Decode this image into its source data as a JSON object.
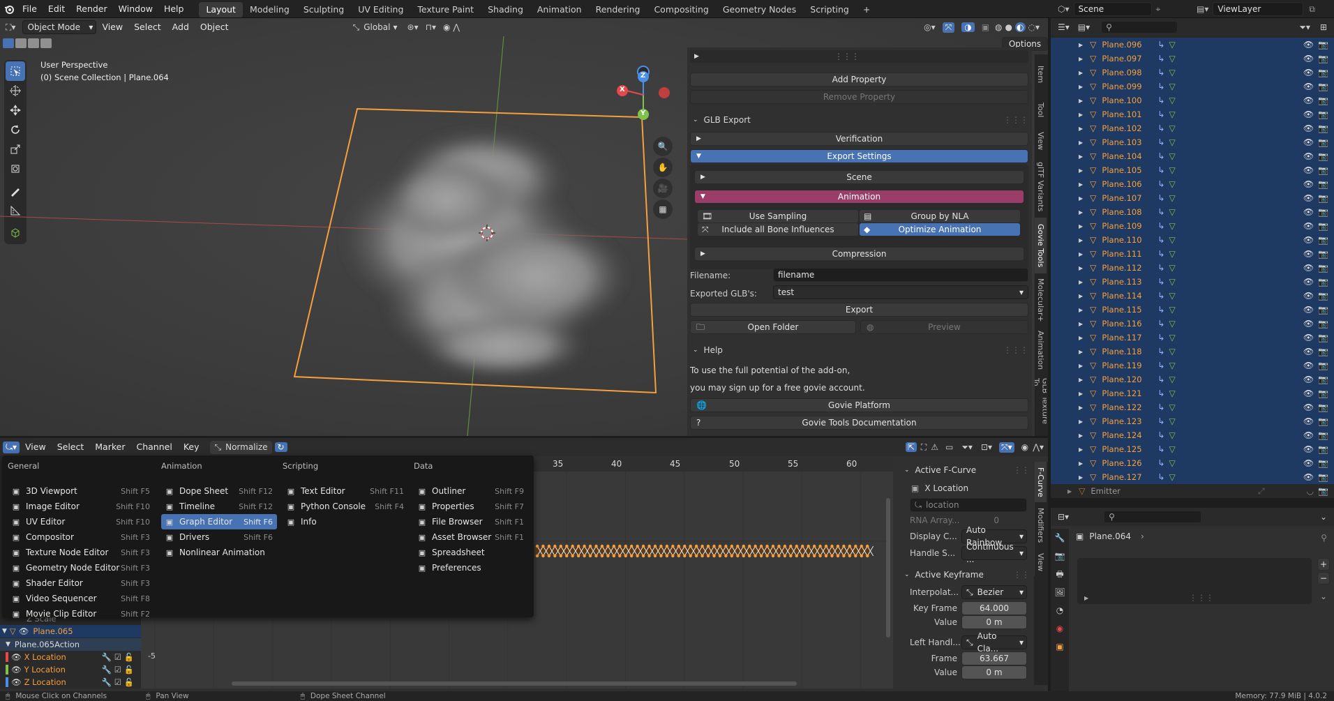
{
  "topbar": {
    "menus": [
      "File",
      "Edit",
      "Render",
      "Window",
      "Help"
    ],
    "workspaces": [
      "Layout",
      "Modeling",
      "Sculpting",
      "UV Editing",
      "Texture Paint",
      "Shading",
      "Animation",
      "Rendering",
      "Compositing",
      "Geometry Nodes",
      "Scripting"
    ],
    "active_workspace": "Layout",
    "add_tab": "+",
    "scene": "Scene",
    "view_layer": "ViewLayer"
  },
  "viewport": {
    "mode": "Object Mode",
    "menus": [
      "View",
      "Select",
      "Add",
      "Object"
    ],
    "transform": "Global",
    "options": "Options",
    "overlay_line1": "User Perspective",
    "overlay_line2": "(0) Scene Collection | Plane.064",
    "gizmo": {
      "z": "Z",
      "y": "Y",
      "x": "X"
    }
  },
  "npanel": {
    "tabs": [
      "Item",
      "Tool",
      "View",
      "glTF Variants",
      "Govie Tools",
      "Molecular+",
      "Animation",
      "GLB Texture To"
    ],
    "add_property": "Add Property",
    "remove_property": "Remove Property",
    "glb_export": "GLB Export",
    "verification": "Verification",
    "export_settings": "Export Settings",
    "scene": "Scene",
    "animation": "Animation",
    "use_sampling": "Use Sampling",
    "group_by_nla": "Group by NLA",
    "include_bone": "Include all Bone Influences",
    "optimize": "Optimize Animation",
    "compression": "Compression",
    "filename_label": "Filename:",
    "filename_value": "filename",
    "exported_label": "Exported GLB's:",
    "exported_value": "test",
    "export": "Export",
    "open_folder": "Open Folder",
    "preview": "Preview",
    "help": "Help",
    "help_line1": "To use the full potential of the add-on,",
    "help_line2": "you may sign up for a free govie account.",
    "govie_platform": "Govie Platform",
    "govie_docs": "Govie Tools Documentation"
  },
  "outliner": {
    "items": [
      "Plane.096",
      "Plane.097",
      "Plane.098",
      "Plane.099",
      "Plane.100",
      "Plane.101",
      "Plane.102",
      "Plane.103",
      "Plane.104",
      "Plane.105",
      "Plane.106",
      "Plane.107",
      "Plane.108",
      "Plane.109",
      "Plane.110",
      "Plane.111",
      "Plane.112",
      "Plane.113",
      "Plane.114",
      "Plane.115",
      "Plane.116",
      "Plane.117",
      "Plane.118",
      "Plane.119",
      "Plane.120",
      "Plane.121",
      "Plane.122",
      "Plane.123",
      "Plane.124",
      "Plane.125",
      "Plane.126",
      "Plane.127"
    ],
    "emitter": "Emitter"
  },
  "properties": {
    "object": "Plane.064"
  },
  "graph": {
    "menus": [
      "View",
      "Select",
      "Marker",
      "Channel",
      "Key"
    ],
    "normalize": "Normalize",
    "ticks": [
      "35",
      "40",
      "45",
      "50",
      "55",
      "60"
    ],
    "y_tick": "-5",
    "channels": {
      "scale": "Z Scale",
      "object": "Plane.065",
      "action": "Plane.065Action",
      "x": "X Location",
      "y": "Y Location",
      "z": "Z Location"
    },
    "side_tabs": [
      "F-Curve",
      "Modifiers",
      "View"
    ],
    "active_fcurve": "Active F-Curve",
    "fcurve_name": "X Location",
    "data_path": "location",
    "rna_label": "RNA Array...",
    "rna_value": "0",
    "display_color_label": "Display C...",
    "display_color": "Auto Rainbow",
    "handle_smoothing_label": "Handle S...",
    "handle_smoothing": "Continuous ...",
    "active_keyframe": "Active Keyframe",
    "interp_label": "Interpolat...",
    "interp": "Bezier",
    "keyframe_label": "Key Frame",
    "keyframe": "64.000",
    "value_label": "Value",
    "value": "0 m",
    "left_handle_label": "Left Handl...",
    "left_handle": "Auto Cla...",
    "frame_label": "Frame",
    "frame": "63.667",
    "value2_label": "Value",
    "value2": "0 m"
  },
  "editor_menu": {
    "columns": [
      {
        "title": "General",
        "items": [
          {
            "label": "3D Viewport",
            "key": "Shift F5",
            "icon": "viewport-icon"
          },
          {
            "label": "Image Editor",
            "key": "Shift F10",
            "icon": "image-icon"
          },
          {
            "label": "UV Editor",
            "key": "Shift F10",
            "icon": "uv-icon"
          },
          {
            "label": "Compositor",
            "key": "Shift F3",
            "icon": "node-icon"
          },
          {
            "label": "Texture Node Editor",
            "key": "Shift F3",
            "icon": "texture-icon"
          },
          {
            "label": "Geometry Node Editor",
            "key": "Shift F3",
            "icon": "geonode-icon"
          },
          {
            "label": "Shader Editor",
            "key": "Shift F3",
            "icon": "shader-icon"
          },
          {
            "label": "Video Sequencer",
            "key": "Shift F8",
            "icon": "sequencer-icon"
          },
          {
            "label": "Movie Clip Editor",
            "key": "Shift F2",
            "icon": "clip-icon"
          }
        ]
      },
      {
        "title": "Animation",
        "items": [
          {
            "label": "Dope Sheet",
            "key": "Shift F12",
            "icon": "dopesheet-icon"
          },
          {
            "label": "Timeline",
            "key": "Shift F12",
            "icon": "timeline-icon"
          },
          {
            "label": "Graph Editor",
            "key": "Shift F6",
            "icon": "graph-icon",
            "active": true
          },
          {
            "label": "Drivers",
            "key": "Shift F6",
            "icon": "drivers-icon"
          },
          {
            "label": "Nonlinear Animation",
            "key": "",
            "icon": "nla-icon"
          }
        ]
      },
      {
        "title": "Scripting",
        "items": [
          {
            "label": "Text Editor",
            "key": "Shift F11",
            "icon": "text-icon"
          },
          {
            "label": "Python Console",
            "key": "Shift F4",
            "icon": "console-icon"
          },
          {
            "label": "Info",
            "key": "",
            "icon": "info-icon"
          }
        ]
      },
      {
        "title": "Data",
        "items": [
          {
            "label": "Outliner",
            "key": "Shift F9",
            "icon": "outliner-icon"
          },
          {
            "label": "Properties",
            "key": "Shift F7",
            "icon": "properties-icon"
          },
          {
            "label": "File Browser",
            "key": "Shift F1",
            "icon": "filebrowser-icon"
          },
          {
            "label": "Asset Browser",
            "key": "Shift F1",
            "icon": "asset-icon"
          },
          {
            "label": "Spreadsheet",
            "key": "",
            "icon": "spreadsheet-icon"
          },
          {
            "label": "Preferences",
            "key": "",
            "icon": "preferences-icon"
          }
        ]
      }
    ]
  },
  "status": {
    "left": "Mouse Click on Channels",
    "mid": "Pan View",
    "mid2": "Dope Sheet Channel",
    "right": "Memory: 77.9 MiB | 4.0.2"
  },
  "colors": {
    "accent": "#4772b3",
    "select": "#f5a03c",
    "anim": "#9a3d68",
    "xaxis": "#e7484a",
    "yaxis": "#7ec24a",
    "zaxis": "#4a8fe8"
  }
}
